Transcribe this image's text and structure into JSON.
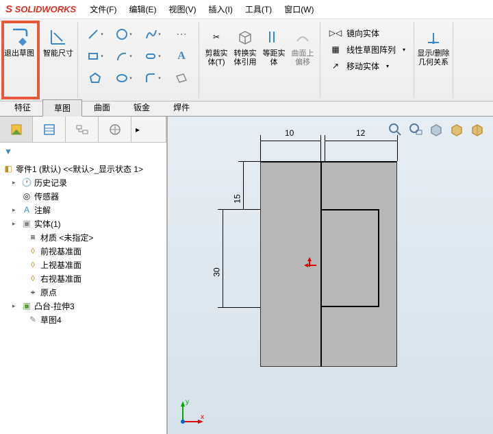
{
  "app": {
    "name": "SOLIDWORKS"
  },
  "menu": {
    "file": "文件(F)",
    "edit": "编辑(E)",
    "view": "视图(V)",
    "insert": "插入(I)",
    "tools": "工具(T)",
    "window": "窗口(W)"
  },
  "ribbon": {
    "exit": "退出草图",
    "smart_dim": "智能尺寸",
    "trim": "剪裁实体(T)",
    "convert": "转换实体引用",
    "offset": "等距实体",
    "surf": "曲面上偏移",
    "mirror": "镜向实体",
    "pattern": "线性草图阵列",
    "move": "移动实体",
    "display": "显示/删除几何关系"
  },
  "tabs": {
    "feature": "特征",
    "sketch": "草图",
    "surface": "曲面",
    "sheet": "钣金",
    "weld": "焊件"
  },
  "tree": {
    "root": "零件1 (默认) <<默认>_显示状态 1>",
    "history": "历史记录",
    "sensors": "传感器",
    "annotations": "注解",
    "solid": "实体(1)",
    "material": "材质 <未指定>",
    "front": "前视基准面",
    "top": "上视基准面",
    "right": "右视基准面",
    "origin": "原点",
    "extrude": "凸台-拉伸3",
    "sketch": "草图4"
  },
  "dims": {
    "d1": "10",
    "d2": "12",
    "d3": "15",
    "d4": "30"
  },
  "axes": {
    "x": "x",
    "y": "y"
  }
}
